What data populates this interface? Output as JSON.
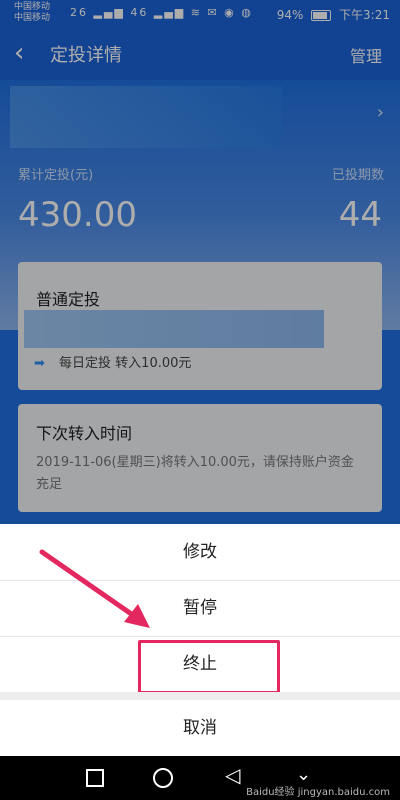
{
  "status": {
    "carrier1": "中国移动",
    "carrier2": "中国移动",
    "icons": "26 ▂▄▆ 46 ▂▄▆ ≋ ✉ ◉ ◍",
    "battery_text": "94%",
    "time": "下午3:21"
  },
  "nav": {
    "back_icon": "‹",
    "title": "定投详情",
    "manage": "管理"
  },
  "hero": {
    "chevron": "›",
    "label_total": "累计定投(元)",
    "label_periods": "已投期数",
    "amount": "430.00",
    "periods": "44"
  },
  "card": {
    "title": "普通定投",
    "rule_arrow": "➡",
    "rule_text": "每日定投 转入10.00元"
  },
  "next": {
    "title": "下次转入时间",
    "text": "2019-11-06(星期三)将转入10.00元，请保持账户资金充足"
  },
  "sheet": {
    "modify": "修改",
    "pause": "暂停",
    "terminate": "终止",
    "cancel": "取消"
  },
  "sysnav": {
    "back": "◁",
    "down": "⌄"
  },
  "watermark": "Baidu经验 jingyan.baidu.com",
  "colors": {
    "primary": "#1b64d8",
    "highlight": "#e2285f",
    "sheet": "#ffffff"
  }
}
